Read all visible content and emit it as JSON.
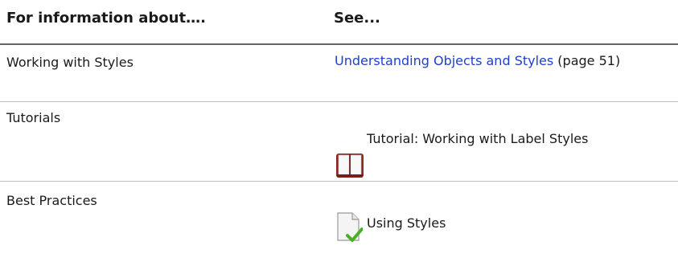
{
  "header": {
    "col1": "For information about….",
    "col2": "See..."
  },
  "rows": [
    {
      "topic": "Working with Styles",
      "link_text": "Understanding Objects and Styles",
      "suffix": " (page 51)",
      "icon": ""
    },
    {
      "topic": "Tutorials",
      "link_text": "",
      "suffix": "",
      "label": "Tutorial: Working with Label Styles",
      "icon": "book-icon"
    },
    {
      "topic": "Best Practices",
      "link_text": "",
      "suffix": "",
      "label": "Using Styles",
      "icon": "document-check-icon"
    }
  ],
  "colors": {
    "link": "#1f3fcf",
    "header_rule": "#666666",
    "row_rule": "#bdbdbd",
    "book_red": "#8b2a1f",
    "check_green": "#4caf2a"
  }
}
